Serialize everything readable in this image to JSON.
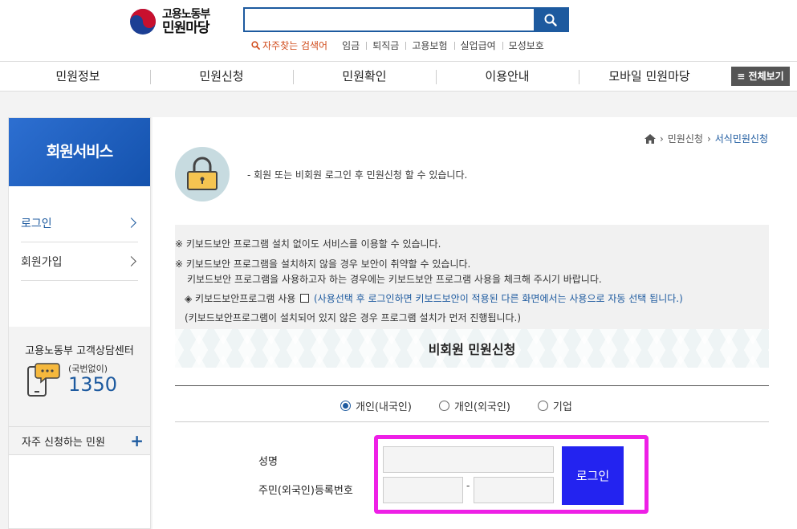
{
  "header": {
    "logo_line1": "고용노동부",
    "logo_line2": "민원마당",
    "search_value": "",
    "keywords_title": "자주찾는 검색어",
    "keywords": [
      "임금",
      "퇴직금",
      "고용보험",
      "실업급여",
      "모성보호"
    ]
  },
  "gnb": {
    "items": [
      "민원정보",
      "민원신청",
      "민원확인",
      "이용안내",
      "모바일 민원마당"
    ],
    "all_label": "≡ 전체보기"
  },
  "sidebar": {
    "title": "회원서비스",
    "items": [
      {
        "label": "로그인",
        "active": true
      },
      {
        "label": "회원가입",
        "active": false
      }
    ],
    "callcenter": {
      "title": "고용노동부 고객상담센터",
      "sub": "(국번없이)",
      "number": "1350"
    },
    "frequent_label": "자주 신청하는 민원",
    "frequent_icon": "+"
  },
  "breadcrumb": {
    "items": [
      "민원신청",
      "서식민원신청"
    ]
  },
  "notice": "- 회원 또는 비회원 로그인 후 민원신청 할 수 있습니다.",
  "keyboard": {
    "line1": "※ 키보드보안 프로그램 설치 없이도 서비스를 이용할 수 있습니다.",
    "line2": "※ 키보드보안 프로그램을 설치하지 않을 경우 보안이 취약할 수 있습니다.",
    "line3": "키보드보안 프로그램을 사용하고자 하는 경우에는 키보드보안 프로그램 사용을 체크해 주시기 바랍니다.",
    "use_label": "◈ 키보드보안프로그램  사용",
    "use_note": "(사용선택 후 로그인하면 키보드보안이 적용된 다른 화면에서는 사용으로 자동 선택 됩니다.)",
    "line5": "(키보드보안프로그램이 설치되어 있지 않은 경우 프로그램 설치가 먼저 진행됩니다.)"
  },
  "form": {
    "title": "비회원 민원신청",
    "radio_options": [
      "개인(내국인)",
      "개인(외국인)",
      "기업"
    ],
    "radio_selected": "개인(내국인)",
    "name_label": "성명",
    "rrn_label": "주민(외국인)등록번호",
    "rrn_separator": "-",
    "login_button": "로그인"
  },
  "colors": {
    "primary": "#1d5a9f",
    "highlight": "#ee1fe6",
    "login_button": "#2323f0"
  }
}
